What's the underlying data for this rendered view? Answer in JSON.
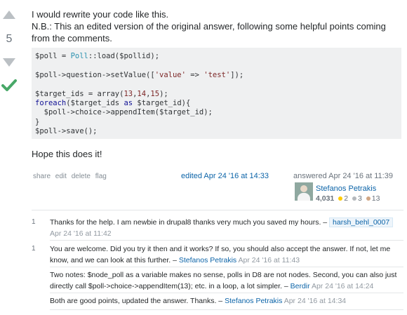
{
  "vote": {
    "score": "5",
    "up_label": "",
    "down_label": ""
  },
  "answer": {
    "intro_line1": "I would rewrite your code like this.",
    "intro_line2": "N.B.: This an edited version of the original answer, following some helpful points coming from the comments.",
    "code_lines": [
      "$poll = Poll::load($pollid);",
      "",
      "$poll->question->setValue(['value' => 'test']);",
      "",
      "$target_ids = array(13,14,15);",
      "foreach($target_ids as $target_id){",
      "  $poll->choice->appendItem($target_id);",
      "}",
      "$poll->save();"
    ],
    "closing": "Hope this does it!"
  },
  "menu": {
    "share": "share",
    "edit": "edit",
    "delete": "delete",
    "flag": "flag"
  },
  "edited": "edited Apr 24 '16 at 14:33",
  "answered": "answered Apr 24 '16 at 11:39",
  "user": {
    "name": "Stefanos Petrakis",
    "reputation": "4,031",
    "gold": "2",
    "silver": "3",
    "bronze": "13",
    "gold_color": "#ffcc01",
    "silver_color": "#b4b8bc",
    "bronze_color": "#d1a684"
  },
  "comments": [
    {
      "score": "1",
      "text": "Thanks for the help. I am newbie in drupal8 thanks very much you saved my hours. –",
      "user": "harsh_behl_0007",
      "date": "Apr 24 '16 at 11:42"
    },
    {
      "score": "1",
      "text": "You are welcome. Did you try it then and it works? If so, you should also accept the answer. If not, let me know, and we can look at this further. –",
      "user": "Stefanos Petrakis",
      "date": "Apr 24 '16 at 11:43"
    },
    {
      "score": "",
      "text": "Two notes: $node_poll as a variable makes no sense, polls in D8 are not nodes. Second, you can also just directly call $poll->choice->appendItem(13); etc. in a loop, a lot simpler. –",
      "user": "Berdir",
      "date": "Apr 24 '16 at 14:24"
    },
    {
      "score": "",
      "text": "Both are good points, updated the answer. Thanks. –",
      "user": "Stefanos Petrakis",
      "date": "Apr 24 '16 at 14:34"
    }
  ]
}
